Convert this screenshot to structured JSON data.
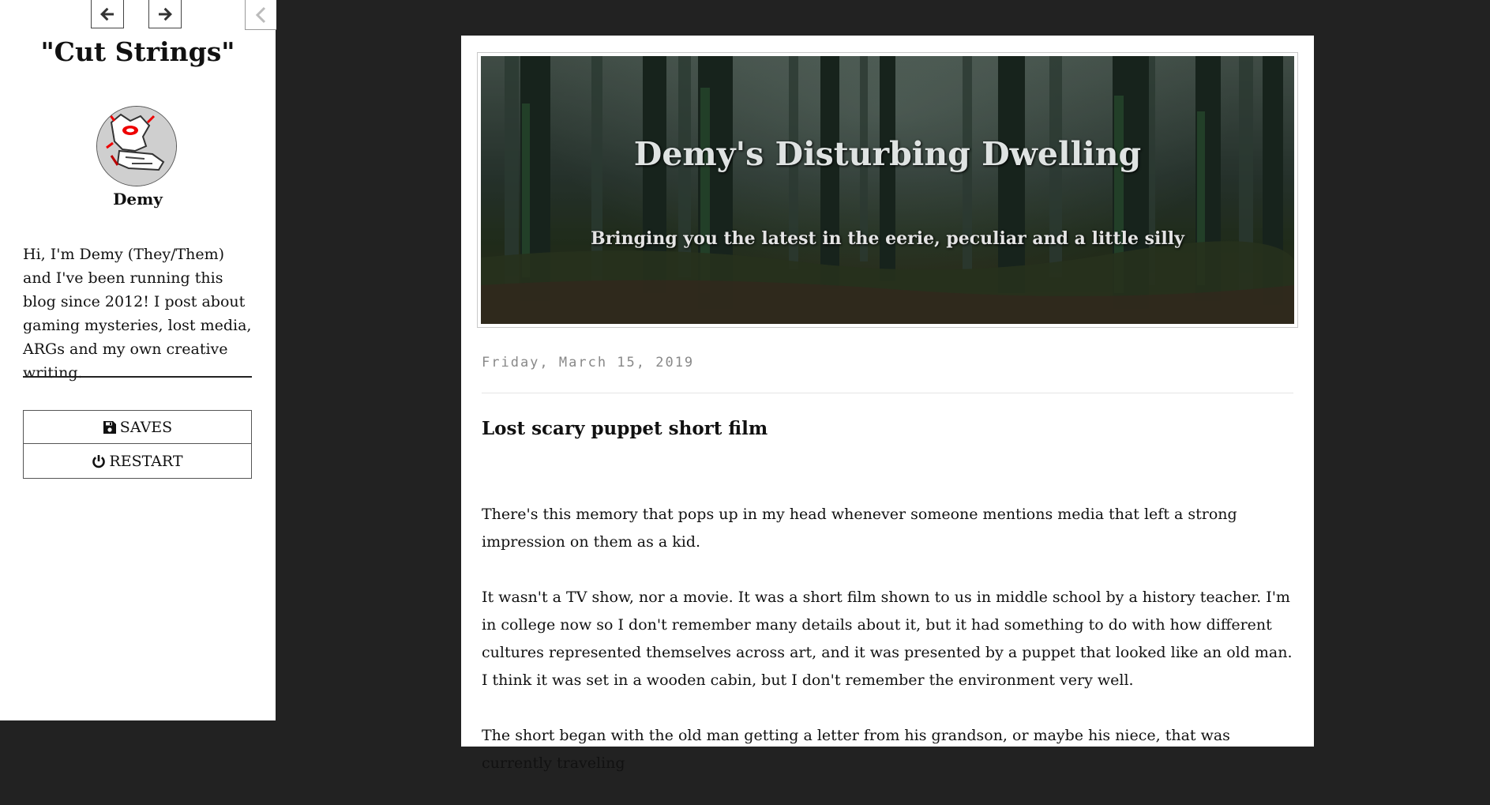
{
  "sidebar": {
    "story_title": "\"Cut Strings\"",
    "author_name": "Demy",
    "author_bio": "Hi, I'm Demy (They/Them) and I've been running this blog since 2012! I post about gaming mysteries, lost media, ARGs and my own creative writing.",
    "saves_label": "SAVES",
    "restart_label": "RESTART",
    "icons": {
      "back": "arrow-left-icon",
      "forward": "arrow-right-icon",
      "toggle": "chevron-left-icon",
      "saves": "floppy-disk-icon",
      "restart": "power-icon"
    }
  },
  "blog": {
    "title": "Demy's Disturbing Dwelling",
    "tagline": "Bringing you the latest in the eerie, peculiar and a little silly"
  },
  "post": {
    "date": "Friday, March 15, 2019",
    "title": "Lost scary puppet short film",
    "paragraphs": [
      "There's this memory that pops up in my head whenever someone mentions media that left a strong impression on them as a kid.",
      "It wasn't a TV show, nor a movie. It was a short film shown to us in middle school by a history teacher. I'm in college now so I don't remember many details about it, but it had something to do with how different cultures represented themselves across art, and it was presented by a puppet that looked like an old man. I think it was set in a wooden cabin, but I don't remember the environment very well.",
      "The short began with the old man getting a letter from his grandson, or maybe his niece, that was currently traveling"
    ]
  },
  "colors": {
    "background": "#222222",
    "page": "#ffffff",
    "text": "#111111",
    "date": "#888888"
  }
}
